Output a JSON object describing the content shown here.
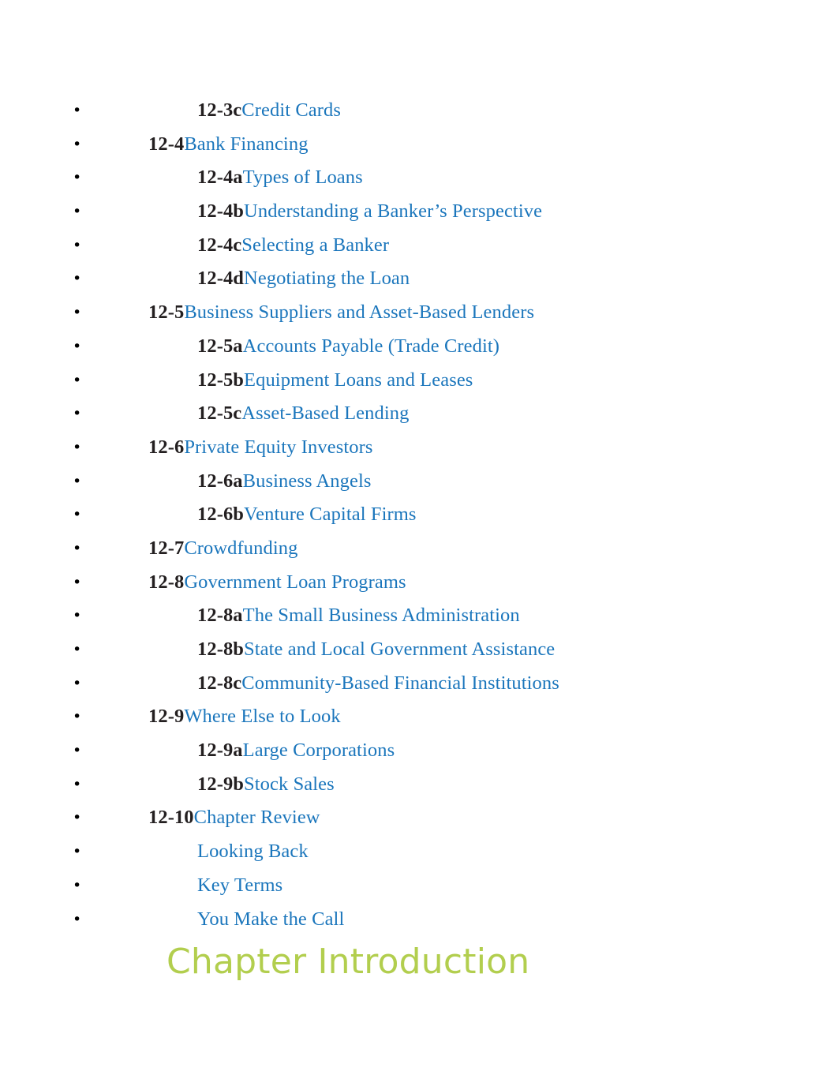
{
  "page": {
    "background_color": "#ffffff",
    "link_color": "#1b76bc",
    "number_color": "#231f20",
    "heading_color": "#b2ce4e",
    "bullet_glyph": "•"
  },
  "toc": {
    "items": [
      {
        "number": "12-3c",
        "title": "Credit Cards",
        "level": 2
      },
      {
        "number": "12-4",
        "title": "Bank Financing",
        "level": 1
      },
      {
        "number": "12-4a",
        "title": "Types of Loans",
        "level": 2
      },
      {
        "number": "12-4b",
        "title": "Understanding a Banker’s Perspective",
        "level": 2
      },
      {
        "number": "12-4c",
        "title": "Selecting a Banker",
        "level": 2
      },
      {
        "number": "12-4d",
        "title": "Negotiating the Loan",
        "level": 2
      },
      {
        "number": "12-5",
        "title": "Business Suppliers and Asset-Based Lenders",
        "level": 1
      },
      {
        "number": "12-5a",
        "title": "Accounts Payable (Trade Credit)",
        "level": 2
      },
      {
        "number": "12-5b",
        "title": "Equipment Loans and Leases",
        "level": 2
      },
      {
        "number": "12-5c",
        "title": "Asset-Based Lending",
        "level": 2
      },
      {
        "number": "12-6",
        "title": "Private Equity Investors",
        "level": 1
      },
      {
        "number": "12-6a",
        "title": "Business Angels",
        "level": 2
      },
      {
        "number": "12-6b",
        "title": "Venture Capital Firms",
        "level": 2
      },
      {
        "number": "12-7",
        "title": "Crowdfunding",
        "level": 1
      },
      {
        "number": "12-8",
        "title": "Government Loan Programs",
        "level": 1
      },
      {
        "number": "12-8a",
        "title": "The Small Business Administration",
        "level": 2
      },
      {
        "number": "12-8b",
        "title": "State and Local Government Assistance",
        "level": 2
      },
      {
        "number": "12-8c",
        "title": "Community-Based Financial Institutions",
        "level": 2
      },
      {
        "number": "12-9",
        "title": "Where Else to Look",
        "level": 1
      },
      {
        "number": "12-9a",
        "title": "Large Corporations",
        "level": 2
      },
      {
        "number": "12-9b",
        "title": "Stock Sales",
        "level": 2
      },
      {
        "number": "12-10",
        "title": "Chapter Review",
        "level": 1
      },
      {
        "number": "",
        "title": "Looking Back",
        "level": 2
      },
      {
        "number": "",
        "title": "Key Terms",
        "level": 2
      },
      {
        "number": "",
        "title": "You Make the Call",
        "level": 2
      }
    ]
  },
  "heading": {
    "text": "Chapter Introduction"
  }
}
